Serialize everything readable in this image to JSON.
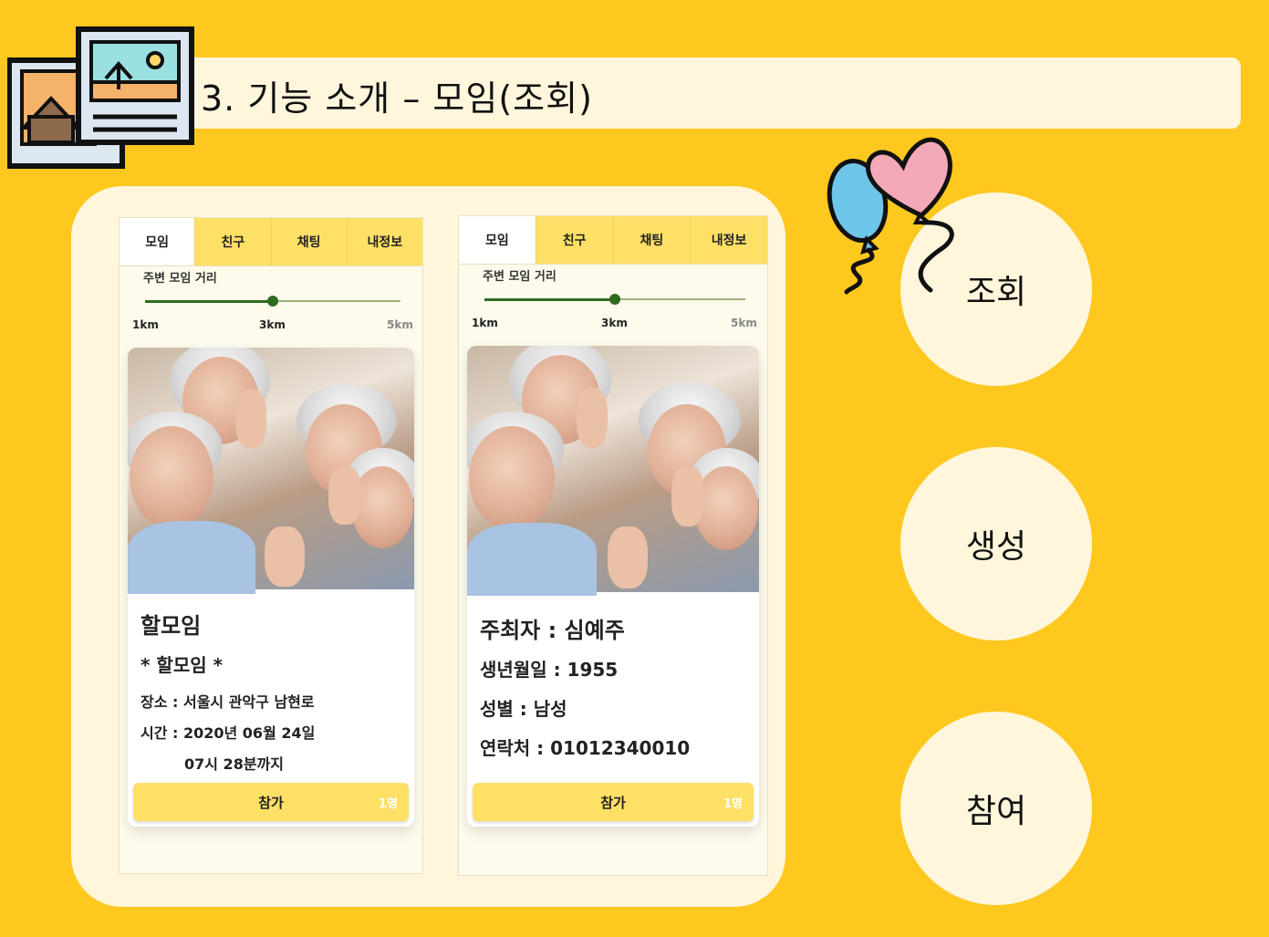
{
  "title": "3. 기능 소개 – 모임(조회)",
  "icons": {
    "picture_icon": "picture-icon",
    "balloons_icon": "balloons-icon"
  },
  "colors": {
    "background": "#FFC81E",
    "panel": "#FFF6DC",
    "tab_inactive": "#FFE066",
    "slider": "#2F6B1F"
  },
  "phones": [
    {
      "tabs": [
        "모임",
        "친구",
        "채팅",
        "내정보"
      ],
      "active_tab": "모임",
      "distance": {
        "label": "주변 모임 거리",
        "ticks": [
          "1km",
          "3km",
          "5km"
        ],
        "value_fraction": 0.5
      },
      "card": {
        "title": "할모임",
        "subtitle": "* 할모임 *",
        "place": "장소 : 서울시 관악구 남현로",
        "time": "시간 : 2020년 06월 24일",
        "time_cont": "07시 28분까지"
      },
      "join": {
        "label": "참가",
        "count": "1명"
      }
    },
    {
      "tabs": [
        "모임",
        "친구",
        "채팅",
        "내정보"
      ],
      "active_tab": "모임",
      "distance": {
        "label": "주변 모임 거리",
        "ticks": [
          "1km",
          "3km",
          "5km"
        ],
        "value_fraction": 0.5
      },
      "card": {
        "host": "주최자 : 심예주",
        "birth": "생년월일 : 1955",
        "gender": "성별 : 남성",
        "contact": "연락처 : 01012340010"
      },
      "join": {
        "label": "참가",
        "count": "1명"
      }
    }
  ],
  "features": [
    "조회",
    "생성",
    "참여"
  ]
}
